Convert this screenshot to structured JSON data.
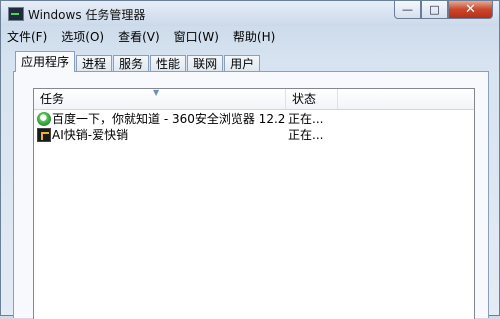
{
  "window": {
    "title": "Windows 任务管理器",
    "controls": {
      "minimize": "—",
      "maximize": "□",
      "close": "✕"
    }
  },
  "menu": [
    "文件(F)",
    "选项(O)",
    "查看(V)",
    "窗口(W)",
    "帮助(H)"
  ],
  "tabs": [
    {
      "label": "应用程序",
      "active": true
    },
    {
      "label": "进程",
      "active": false
    },
    {
      "label": "服务",
      "active": false
    },
    {
      "label": "性能",
      "active": false
    },
    {
      "label": "联网",
      "active": false
    },
    {
      "label": "用户",
      "active": false
    }
  ],
  "table": {
    "columns": [
      "任务",
      "状态"
    ],
    "rows": [
      {
        "task": "百度一下，你就知道 - 360安全浏览器 12.2",
        "status": "正在...",
        "icon": "360-browser-icon"
      },
      {
        "task": "AI快销-爱快销",
        "status": "正在...",
        "icon": "ai-app-icon"
      }
    ]
  }
}
